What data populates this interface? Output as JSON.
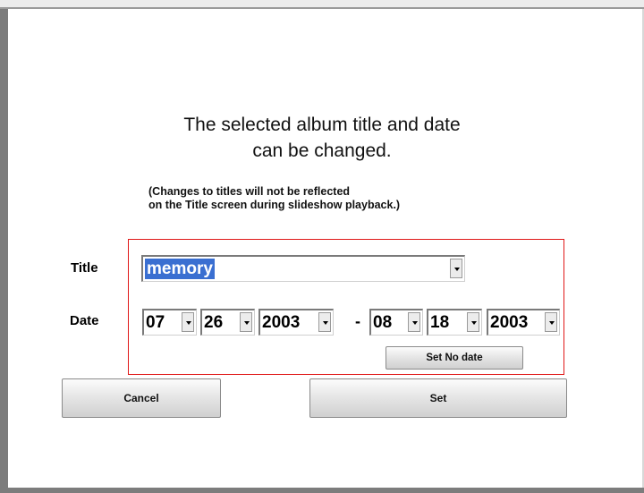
{
  "message": {
    "line1": "The selected album title and date",
    "line2": "can be changed.",
    "note_line1": "(Changes to titles will not be reflected",
    "note_line2": "on the Title screen during slideshow playback.)"
  },
  "form": {
    "title_label": "Title",
    "title_value": "memory",
    "date_label": "Date",
    "start_date": {
      "month": "07",
      "day": "26",
      "year": "2003"
    },
    "separator": "-",
    "end_date": {
      "month": "08",
      "day": "18",
      "year": "2003"
    },
    "set_no_date_label": "Set No date"
  },
  "buttons": {
    "cancel_label": "Cancel",
    "set_label": "Set"
  },
  "colors": {
    "highlight_border": "#e01818",
    "selection": "#3a6fd1"
  }
}
